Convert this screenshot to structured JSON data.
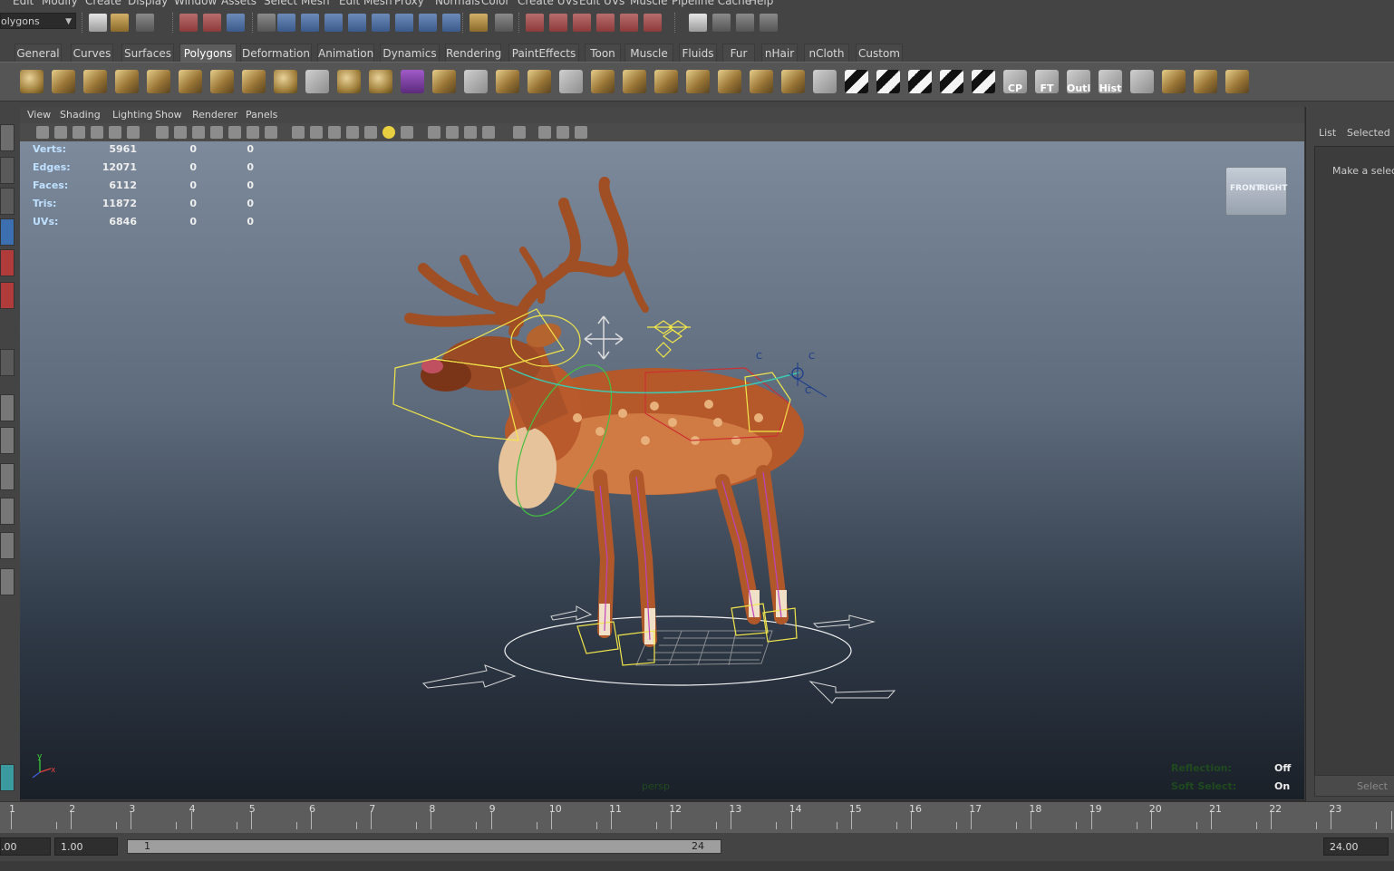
{
  "menu": [
    "Edit",
    "Modify",
    "Create",
    "Display",
    "Window",
    "Assets",
    "Select",
    "Mesh",
    "Edit Mesh",
    "Proxy",
    "Normals",
    "Color",
    "Create UVs",
    "Edit UVs",
    "Muscle",
    "Pipeline Cache",
    "Help"
  ],
  "status_line": {
    "mode": "olygons"
  },
  "shelf_tabs": [
    "General",
    "Curves",
    "Surfaces",
    "Polygons",
    "Deformation",
    "Animation",
    "Dynamics",
    "Rendering",
    "PaintEffects",
    "Toon",
    "Muscle",
    "Fluids",
    "Fur",
    "nHair",
    "nCloth",
    "Custom"
  ],
  "shelf_labels": {
    "cp": "CP",
    "ft": "FT",
    "outl": "Outl",
    "hist": "Hist"
  },
  "panel_menu": [
    "View",
    "Shading",
    "Lighting",
    "Show",
    "Renderer",
    "Panels"
  ],
  "hud": {
    "rows": [
      {
        "label": "Verts:",
        "a": "5961",
        "b": "0",
        "c": "0"
      },
      {
        "label": "Edges:",
        "a": "12071",
        "b": "0",
        "c": "0"
      },
      {
        "label": "Faces:",
        "a": "6112",
        "b": "0",
        "c": "0"
      },
      {
        "label": "Tris:",
        "a": "11872",
        "b": "0",
        "c": "0"
      },
      {
        "label": "UVs:",
        "a": "6846",
        "b": "0",
        "c": "0"
      }
    ],
    "reflection_label": "Reflection:",
    "reflection_value": "Off",
    "soft_select_label": "Soft Select:",
    "soft_select_value": "On",
    "camera": "persp",
    "axis_y": "y",
    "axis_x": "x",
    "rig_c": "C"
  },
  "viewcube": {
    "front": "FRONT",
    "right": "RIGHT"
  },
  "right_panel": {
    "tab_list": "List",
    "tab_selected": "Selected",
    "message": "Make a selecti",
    "select_button": "Select"
  },
  "timeline": {
    "ticks": [
      "1",
      "2",
      "3",
      "4",
      "5",
      "6",
      "7",
      "8",
      "9",
      "10",
      "11",
      "12",
      "13",
      "14",
      "15",
      "16",
      "17",
      "18",
      "19",
      "20",
      "21",
      "22",
      "23"
    ],
    "start_time": ".00",
    "playback_start": "1.00",
    "range_start": "1",
    "range_end": "24",
    "end_time": "24.00"
  }
}
